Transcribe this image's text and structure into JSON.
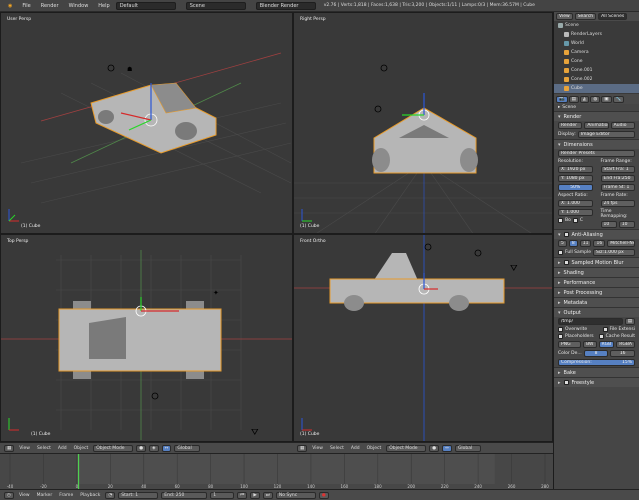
{
  "menubar": {
    "items": [
      "File",
      "Render",
      "Window",
      "Help"
    ],
    "layout": "Default",
    "scene": "Scene",
    "engine": "Blender Render",
    "stats": "v2.76 | Verts:1,818 | Faces:1,638 | Tris:3,200 | Objects:1/11 | Lamps:0/3 | Mem:36.57M | Cube"
  },
  "viewports": {
    "top_left": "User Persp",
    "top_right": "Right Persp",
    "bottom_left": "Top Persp",
    "bottom_right": "Front Ortho",
    "object_label": "(1) Cube"
  },
  "view_header": {
    "view": "View",
    "select": "Select",
    "add": "Add",
    "object": "Object",
    "mode": "Object Mode",
    "pivot": "Global"
  },
  "outliner": {
    "tabs": [
      "View",
      "Search",
      "All Scenes"
    ],
    "items": [
      "Scene",
      "RenderLayers",
      "World",
      "Camera",
      "Cone",
      "Cone.001",
      "Cone.002",
      "Cube"
    ]
  },
  "properties": {
    "breadcrumb": "Scene",
    "render_panel": "Render",
    "render_buttons": [
      "Render",
      "Animation",
      "Audio"
    ],
    "display_label": "Display:",
    "display_value": "Image Editor",
    "dimensions_panel": "Dimensions",
    "render_presets": "Render Presets",
    "resolution_label": "Resolution:",
    "res_x": "X: 1920 px",
    "res_y": "Y: 1080 px",
    "res_pct": "50%",
    "frame_range_label": "Frame Range:",
    "start_frame": "Start Fra: 1",
    "end_frame": "End Fra:250",
    "frame_step": "Frame St: 1",
    "aspect_label": "Aspect Ratio:",
    "aspect_x": "X: 1.000",
    "aspect_y": "Y: 1.000",
    "frame_rate_label": "Frame Rate:",
    "frame_rate": "24 fps",
    "time_remap_label": "Time Remapping:",
    "remap_old": "10",
    "remap_new": "10",
    "border_label": "Bo",
    "crop_label": "C",
    "aa_panel": "Anti-Aliasing",
    "aa_samples": [
      "5",
      "8",
      "11",
      "16"
    ],
    "aa_filter": "Mitchell-Net...",
    "full_sample": "Full Sample",
    "aa_size": "Siz:1.000 px",
    "panels_collapsed": [
      "Sampled Motion Blur",
      "Shading",
      "Performance",
      "Post Processing",
      "Metadata"
    ],
    "output_panel": "Output",
    "output_path": "/tmp/",
    "overwrite": "Overwrite",
    "file_extensions": "File Extensi",
    "placeholders": "Placeholders",
    "cache_result": "Cache Result",
    "format": "PNG",
    "color_modes": [
      "BW",
      "RGB",
      "RGBA"
    ],
    "color_depth_label": "Color De...",
    "color_depth_8": "8",
    "color_depth_16": "16",
    "compression": "Compression:",
    "compression_value": "15%",
    "bake_panel": "Bake",
    "freestyle_panel": "Freestyle"
  },
  "timeline": {
    "view": "View",
    "marker": "Marker",
    "frame": "Frame",
    "playback": "Playback",
    "start": "Start:",
    "start_val": "1",
    "end": "End:",
    "end_val": "250",
    "current": "1",
    "sync": "No Sync",
    "ticks": [
      "-40",
      "-20",
      "0",
      "20",
      "40",
      "60",
      "80",
      "100",
      "120",
      "140",
      "160",
      "180",
      "200",
      "220",
      "240",
      "260",
      "280"
    ]
  }
}
